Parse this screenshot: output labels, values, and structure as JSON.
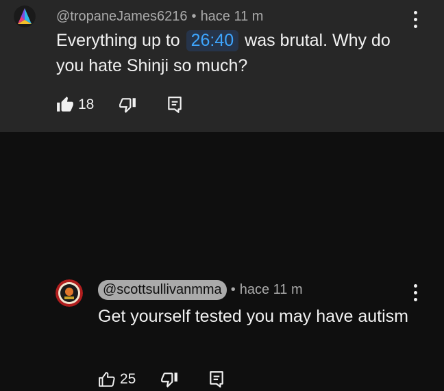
{
  "comments": [
    {
      "handle": "@tropaneJames6216",
      "separator": "•",
      "time": "hace 11 m",
      "text_before": "Everything up to",
      "timestamp_link": "26:40",
      "text_after": "was brutal. Why do you hate Shinji so much?",
      "likes": "18",
      "avatar_icon": "prism-avatar-icon"
    },
    {
      "handle": "@scottsullivanmma",
      "separator": "•",
      "time": "hace 11 m",
      "text": "Get yourself tested you may have autism",
      "likes": "25",
      "avatar_icon": "fight-badge-avatar-icon"
    }
  ],
  "icons": {
    "like": "thumbs-up-icon",
    "dislike": "thumbs-down-icon",
    "reply": "reply-icon",
    "menu": "more-vert-icon"
  },
  "colors": {
    "highlighted_bg": "#272727",
    "page_bg": "#0f0f0f",
    "link": "#3ea6ff",
    "secondary_text": "#aaaaaa"
  }
}
